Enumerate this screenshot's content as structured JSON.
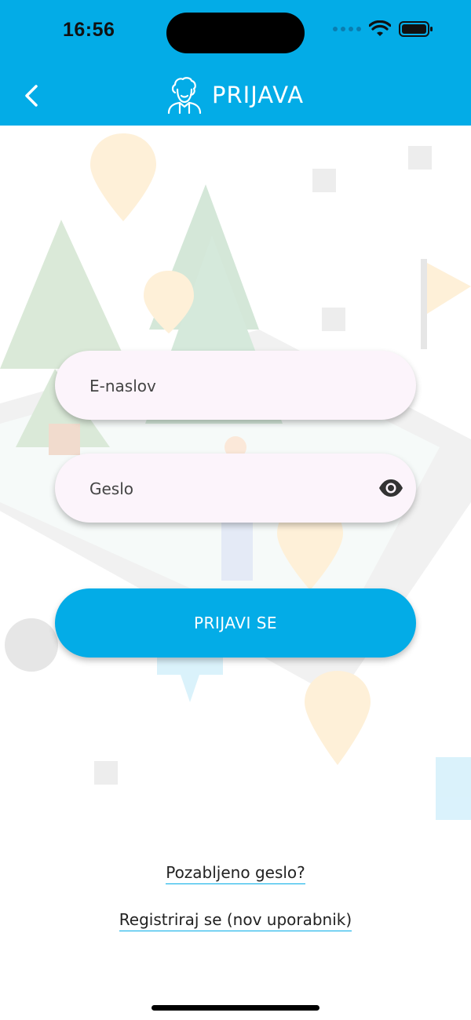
{
  "status_bar": {
    "time": "16:56"
  },
  "header": {
    "title": "PRIJAVA",
    "back_icon": "chevron-left-icon",
    "user_icon": "user-icon"
  },
  "form": {
    "email_placeholder": "E-naslov",
    "password_placeholder": "Geslo",
    "toggle_icon": "eye-icon",
    "submit_label": "PRIJAVI SE"
  },
  "links": {
    "forgot_password": "Pozabljeno geslo?",
    "register": "Registriraj se (nov uporabnik)"
  },
  "colors": {
    "accent": "#03ace7",
    "field_bg": "#fcf4fb"
  }
}
